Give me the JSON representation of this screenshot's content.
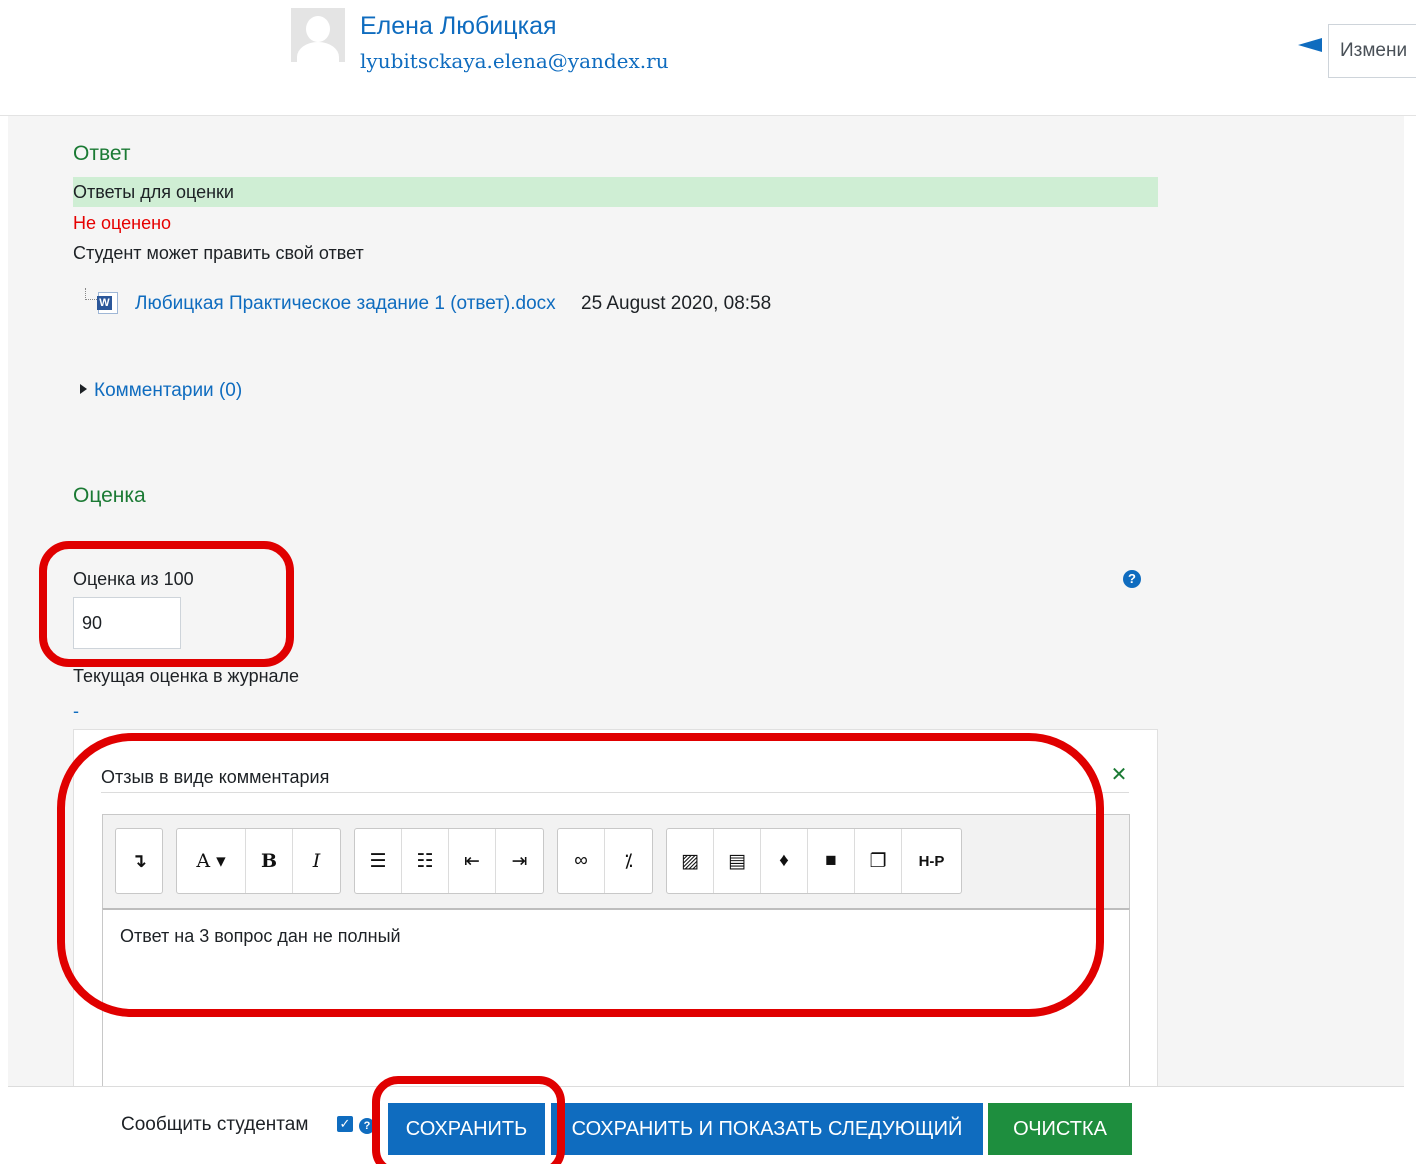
{
  "header": {
    "user_name": "Елена Любицкая",
    "user_email": "lyubitsckaya.elena@yandex.ru",
    "change_user_label": "Измени"
  },
  "answer": {
    "title": "Ответ",
    "status": "Ответы для оценки",
    "grade_status": "Не оценено",
    "edit_status": "Студент может править свой ответ",
    "file_name": "Любицкая Практическое задание 1 (ответ).docx",
    "file_date": "25 August 2020, 08:58",
    "comments_label": "Комментарии (0)"
  },
  "grade": {
    "title": "Оценка",
    "label": "Оценка из 100",
    "value": "90",
    "current_label": "Текущая оценка в журнале",
    "current_value": "-"
  },
  "feedback": {
    "label": "Отзыв в виде комментария",
    "text": "Ответ на 3 вопрос дан не полный"
  },
  "toolbar": {
    "groups": [
      [
        "toggle-toolbar-icon"
      ],
      [
        "font-style-icon",
        "bold-icon",
        "italic-icon"
      ],
      [
        "bullet-list-icon",
        "numbered-list-icon",
        "outdent-icon",
        "indent-icon"
      ],
      [
        "link-icon",
        "unlink-icon"
      ],
      [
        "image-icon",
        "media-icon",
        "microphone-icon",
        "video-icon",
        "paste-icon",
        "h5p-icon"
      ]
    ],
    "labels": {
      "font_style": "A ▾",
      "bold": "B",
      "italic": "I",
      "h5p": "H-P"
    }
  },
  "actions": {
    "notify_label": "Сообщить студентам",
    "notify_checked": true,
    "save": "СОХРАНИТЬ",
    "save_next": "СОХРАНИТЬ И ПОКАЗАТЬ СЛЕДУЮЩИЙ",
    "reset": "ОЧИСТКА"
  },
  "colors": {
    "link": "#0f6cbf",
    "section_title": "#1b7a34",
    "status_bar": "#cfeed4",
    "not_graded": "#e60000",
    "primary_button": "#0f6cbf",
    "reset_button": "#1e8e3e",
    "annotation": "#e00000"
  }
}
